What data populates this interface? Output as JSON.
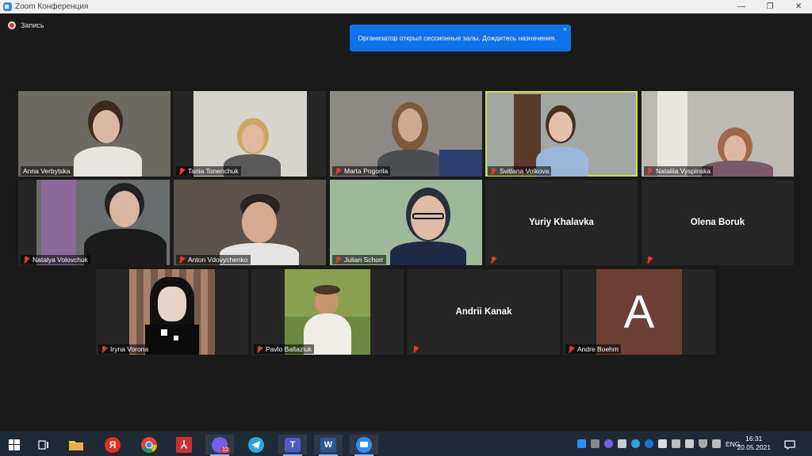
{
  "window": {
    "title": "Zoom Конференция",
    "controls": {
      "minimize": "—",
      "maximize": "❐",
      "close": "✕"
    }
  },
  "recording": {
    "label": "Запись"
  },
  "notification": {
    "text": "Организатор открыл сессионные залы. Дождитесь назначения.",
    "close": "×"
  },
  "participants": [
    {
      "name": "Anna Verbytska",
      "muted": false,
      "video": true
    },
    {
      "name": "Tania Tonenchuk",
      "muted": true,
      "video": true
    },
    {
      "name": "Marta Pogorila",
      "muted": true,
      "video": true
    },
    {
      "name": "Svitlana Volkova",
      "muted": true,
      "video": true,
      "active_speaker": true
    },
    {
      "name": "Nataliia Vyspinska",
      "muted": true,
      "video": true
    },
    {
      "name": "Natalya Volovchuk",
      "muted": true,
      "video": true
    },
    {
      "name": "Anton Vdovychenko",
      "muted": true,
      "video": true
    },
    {
      "name": "Julian Schorr",
      "muted": true,
      "video": true
    },
    {
      "name": "Yuriy Khalavka",
      "muted": true,
      "video": false
    },
    {
      "name": "Olena Boruk",
      "muted": true,
      "video": false
    },
    {
      "name": "Iryna Vorona",
      "muted": true,
      "video": true
    },
    {
      "name": "Pavlo Baltaziuk",
      "muted": true,
      "video": true
    },
    {
      "name": "Andrii Kanak",
      "muted": true,
      "video": false
    },
    {
      "name": "Andre Boehm",
      "muted": true,
      "video": false,
      "avatar_letter": "A"
    }
  ],
  "taskbar": {
    "apps": [
      {
        "icon": "windows-start-icon"
      },
      {
        "icon": "task-view-icon"
      },
      {
        "icon": "file-explorer-icon"
      },
      {
        "icon": "yandex-browser-icon",
        "glyph": "Я"
      },
      {
        "icon": "chrome-icon"
      },
      {
        "icon": "acrobat-icon"
      },
      {
        "icon": "viber-icon",
        "badge": "12"
      },
      {
        "icon": "telegram-icon"
      },
      {
        "icon": "teams-icon"
      },
      {
        "icon": "word-icon",
        "glyph": "W"
      },
      {
        "icon": "zoom-icon"
      }
    ],
    "language": "ENG",
    "time": "16:31",
    "date": "20.05.2021"
  },
  "colors": {
    "background": "#1a1a1a",
    "notification": "#0e72ed",
    "active_speaker": "#c8e04a",
    "muted_icon": "#e53935",
    "taskbar": "#1e2a36"
  }
}
